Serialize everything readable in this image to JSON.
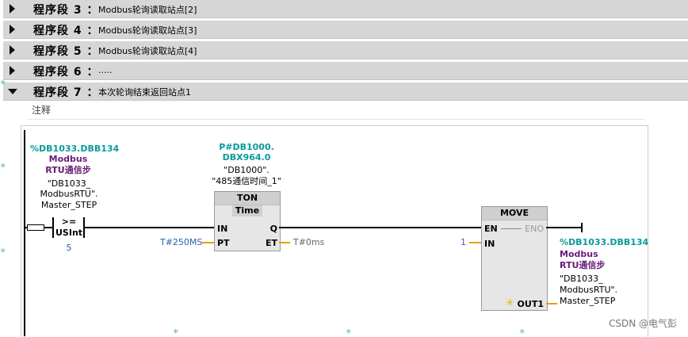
{
  "segments": [
    {
      "label": "程序段",
      "num": "3",
      "colon": "：",
      "title": "Modbus轮询读取站点[2]",
      "state": "collapsed"
    },
    {
      "label": "程序段",
      "num": "4",
      "colon": "：",
      "title": "Modbus轮询读取站点[3]",
      "state": "collapsed"
    },
    {
      "label": "程序段",
      "num": "5",
      "colon": "：",
      "title": "Modbus轮询读取站点[4]",
      "state": "collapsed"
    },
    {
      "label": "程序段",
      "num": "6",
      "colon": "：",
      "title": ".....",
      "state": "collapsed"
    },
    {
      "label": "程序段",
      "num": "7",
      "colon": "：",
      "title": "本次轮询结束返回站点1",
      "state": "expanded"
    }
  ],
  "comment": "注释",
  "compare": {
    "addr": "%DB1033.DBB134",
    "sym1": "Modbus",
    "sym2": "RTU通信步",
    "q1": "\"DB1033_",
    "q2": "ModbusRTU\".",
    "q3": "Master_STEP",
    "op": ">=",
    "type": "USInt",
    "value": "5"
  },
  "ton": {
    "addr1": "P#DB1000.",
    "addr2": "DBX964.0",
    "q1": "\"DB1000\".",
    "q2": "\"485通信时间_1\"",
    "title": "TON",
    "sub": "Time",
    "in": "IN",
    "q": "Q",
    "pt": "PT",
    "et": "ET",
    "pt_val": "T#250MS",
    "et_val": "T#0ms"
  },
  "move": {
    "title": "MOVE",
    "en": "EN",
    "eno": "ENO",
    "in": "IN",
    "in_val": "1",
    "out": "OUT1",
    "out_addr": "%DB1033.DBB134",
    "out_sym1": "Modbus",
    "out_sym2": "RTU通信步",
    "out_q1": "\"DB1033_",
    "out_q2": "ModbusRTU\".",
    "out_q3": "Master_STEP"
  },
  "watermark": "CSDN @电气彭"
}
